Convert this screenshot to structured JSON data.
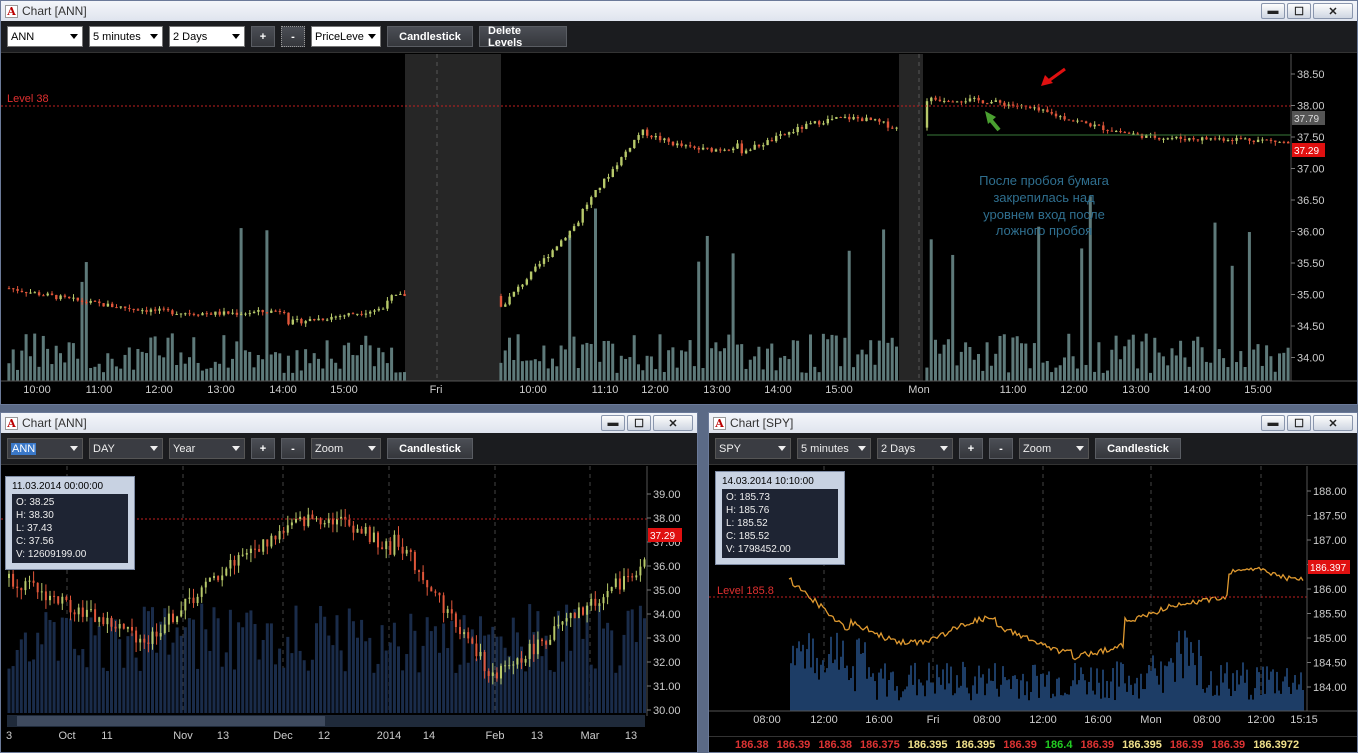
{
  "windows": {
    "main": {
      "title": "Chart [ANN]",
      "toolbar": {
        "symbol": "ANN",
        "interval": "5 minutes",
        "range": "2 Days",
        "plus": "+",
        "minus": "-",
        "tool": "PriceLeve",
        "style": "Candlestick",
        "delete": "Delete Levels"
      },
      "level_label": "Level 38",
      "price_ticks": [
        "38.50",
        "38.00",
        "37.50",
        "37.00",
        "36.50",
        "36.00",
        "35.50",
        "35.00",
        "34.50",
        "34.00"
      ],
      "time_ticks": [
        "10:00",
        "11:00",
        "12:00",
        "13:00",
        "14:00",
        "15:00",
        "Fri",
        "10:00",
        "11:10",
        "12:00",
        "13:00",
        "14:00",
        "15:00",
        "Mon",
        "11:00",
        "12:00",
        "13:00",
        "14:00",
        "15:00"
      ],
      "badge_grey": "37.79",
      "badge_red": "37.29",
      "annotation": [
        "После пробоя  бумага",
        "закрепилась над",
        "уровнем вход после",
        "ложного пробоя"
      ]
    },
    "ann_daily": {
      "title": "Chart [ANN]",
      "toolbar": {
        "symbol": "ANN",
        "interval": "DAY",
        "range": "Year",
        "plus": "+",
        "minus": "-",
        "tool": "Zoom",
        "style": "Candlestick"
      },
      "price_ticks": [
        "39.00",
        "38.00",
        "37.00",
        "36.00",
        "35.00",
        "34.00",
        "33.00",
        "32.00",
        "31.00",
        "30.00"
      ],
      "time_ticks": [
        "3",
        "Oct",
        "11",
        "Nov",
        "13",
        "Dec",
        "12",
        "2014",
        "14",
        "Feb",
        "13",
        "Mar",
        "13"
      ],
      "badge_red": "37.29",
      "tooltip": {
        "date": "11.03.2014 00:00:00",
        "o": "O: 38.25",
        "h": "H: 38.30",
        "l": "L: 37.43",
        "c": "C: 37.56",
        "v": "V: 12609199.00"
      }
    },
    "spy": {
      "title": "Chart [SPY]",
      "toolbar": {
        "symbol": "SPY",
        "interval": "5 minutes",
        "range": "2 Days",
        "plus": "+",
        "minus": "-",
        "tool": "Zoom",
        "style": "Candlestick"
      },
      "level_label": "Level 185.8",
      "price_ticks": [
        "188.00",
        "187.50",
        "187.00",
        "186.50",
        "186.00",
        "185.50",
        "185.00",
        "184.50",
        "184.00"
      ],
      "time_ticks": [
        "08:00",
        "12:00",
        "16:00",
        "Fri",
        "08:00",
        "12:00",
        "16:00",
        "Mon",
        "08:00",
        "12:00",
        "15:15"
      ],
      "badge_red": "186.397",
      "tooltip": {
        "date": "14.03.2014 10:10:00",
        "o": "O: 185.73",
        "h": "H: 185.76",
        "l": "L: 185.52",
        "c": "C: 185.52",
        "v": "V: 1798452.00"
      },
      "ticker_strip": [
        {
          "v": "186.38",
          "c": "#d33"
        },
        {
          "v": "186.39",
          "c": "#d33"
        },
        {
          "v": "186.38",
          "c": "#d33"
        },
        {
          "v": "186.375",
          "c": "#d33"
        },
        {
          "v": "186.395",
          "c": "#f0e08a"
        },
        {
          "v": "186.395",
          "c": "#f0e08a"
        },
        {
          "v": "186.39",
          "c": "#d33"
        },
        {
          "v": "186.4",
          "c": "#2c2"
        },
        {
          "v": "186.39",
          "c": "#d33"
        },
        {
          "v": "186.395",
          "c": "#f0e08a"
        },
        {
          "v": "186.39",
          "c": "#d33"
        },
        {
          "v": "186.39",
          "c": "#d33"
        },
        {
          "v": "186.3972",
          "c": "#f0e08a"
        }
      ]
    }
  },
  "icons": {
    "window": [
      "minimize-icon",
      "maximize-icon",
      "close-icon"
    ]
  },
  "colors": {
    "up": "#b7c96a",
    "down": "#e0563a",
    "volume": "#5e7a7a",
    "level": "#d02020"
  }
}
